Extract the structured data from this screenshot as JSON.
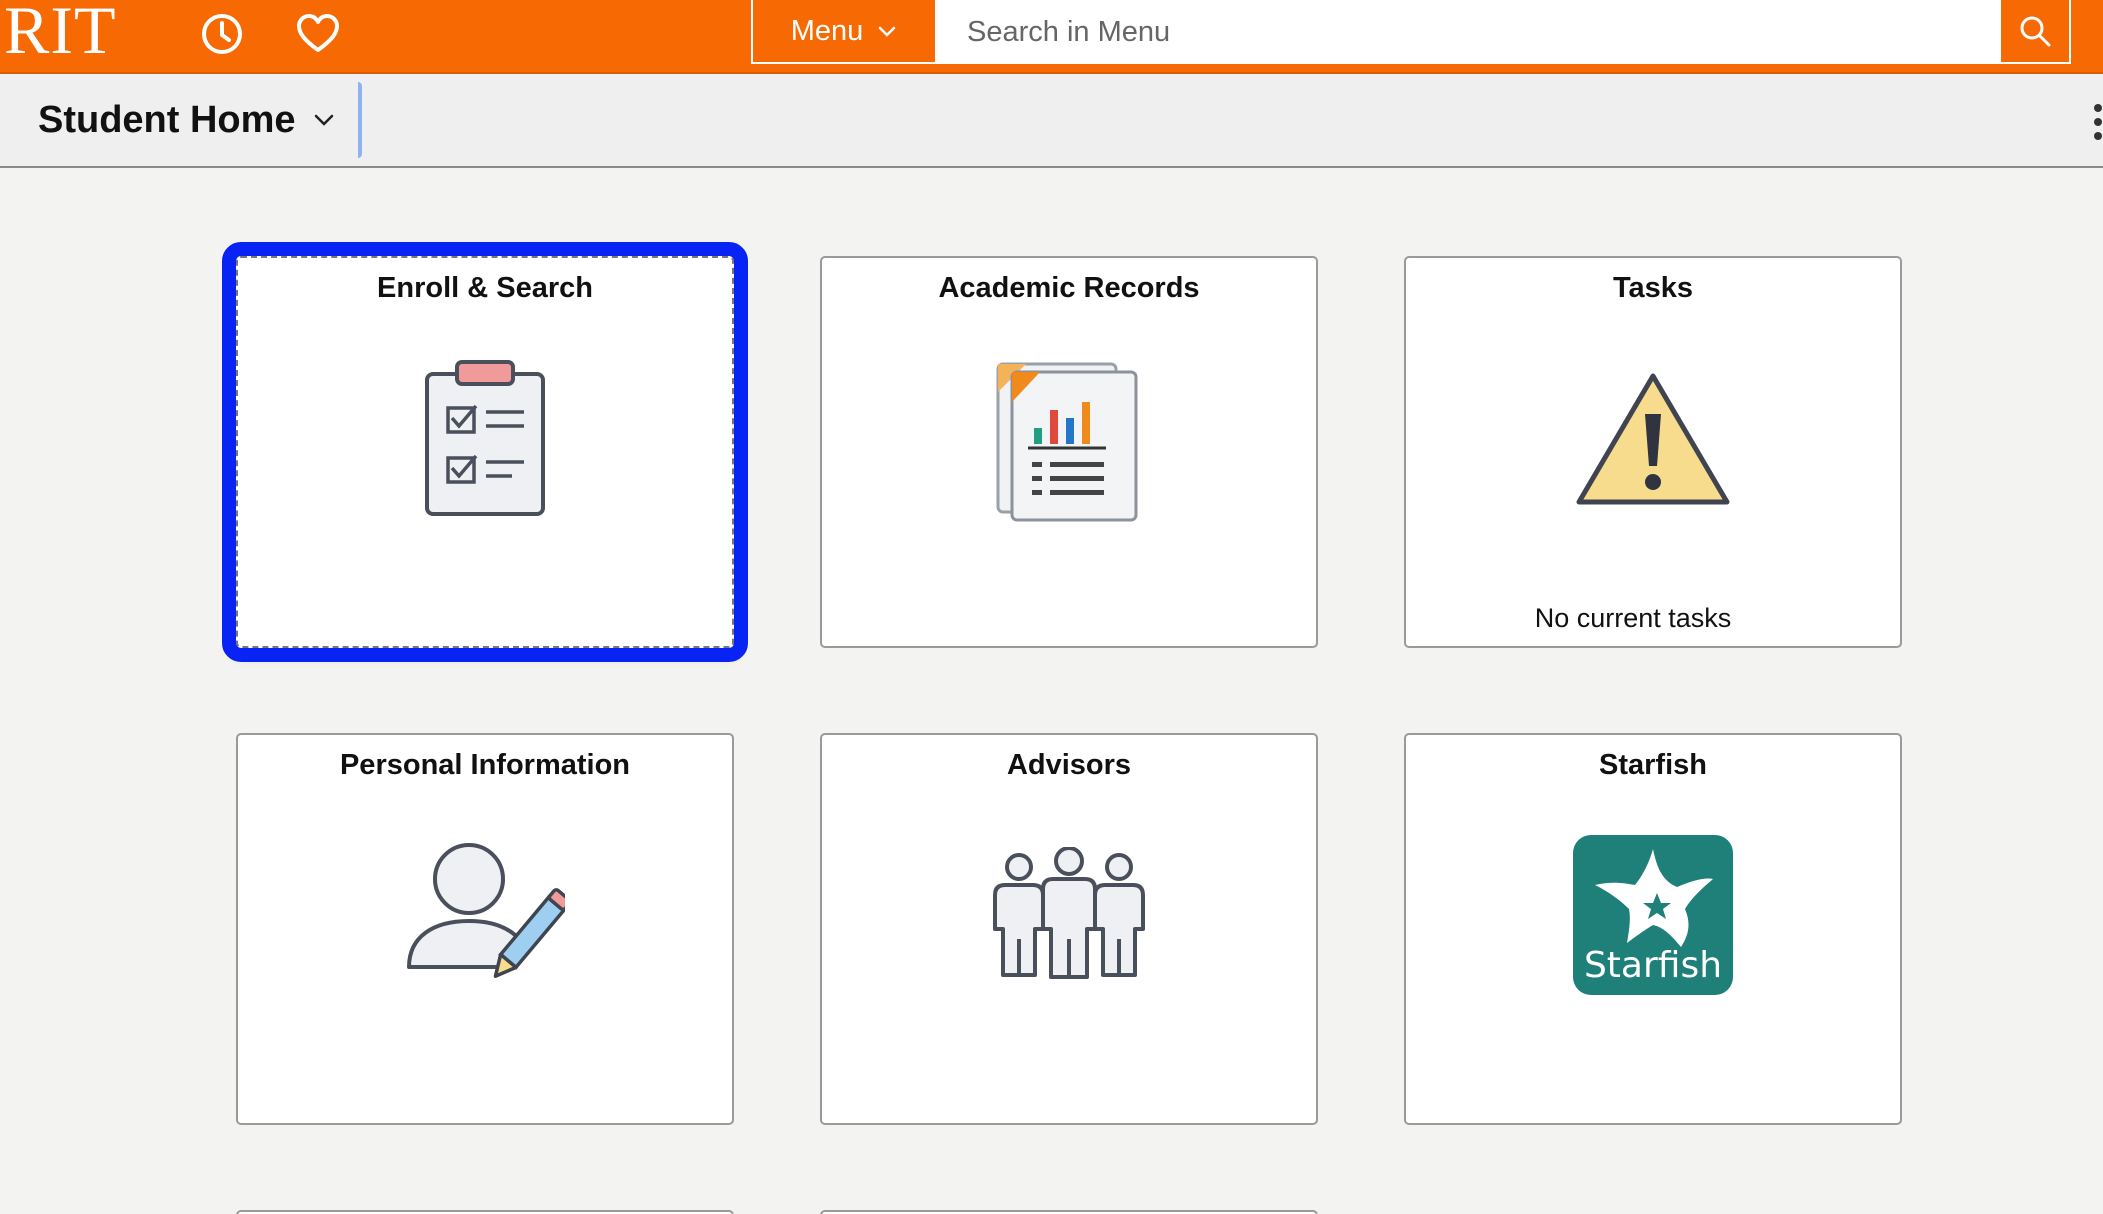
{
  "header": {
    "logo": "RIT",
    "menu_label": "Menu",
    "search_placeholder": "Search in Menu"
  },
  "subheader": {
    "title": "Student Home"
  },
  "tiles": [
    {
      "title": "Enroll & Search",
      "icon": "clipboard-checklist-icon"
    },
    {
      "title": "Academic Records",
      "icon": "report-chart-icon"
    },
    {
      "title": "Tasks",
      "icon": "warning-icon",
      "footer": "No current tasks"
    },
    {
      "title": "Personal Information",
      "icon": "person-edit-icon"
    },
    {
      "title": "Advisors",
      "icon": "people-group-icon"
    },
    {
      "title": "Starfish",
      "icon": "starfish-logo",
      "logo_text": "Starfish"
    }
  ],
  "colors": {
    "brand_orange": "#f76902",
    "focus_blue": "#0a23f5",
    "starfish_teal": "#1f7f79"
  }
}
